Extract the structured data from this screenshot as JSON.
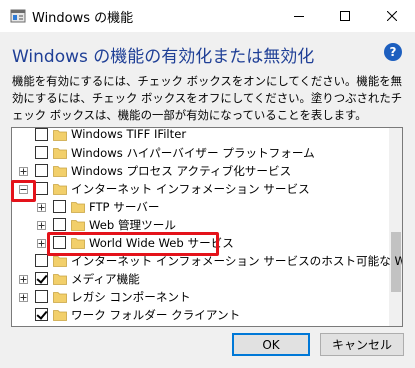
{
  "window": {
    "title": "Windows の機能",
    "heading": "Windows の機能の有効化または無効化",
    "description": "機能を有効にするには、チェック ボックスをオンにしてください。機能を無効にするには、チェック ボックスをオフにしてください。塗りつぶされたチェック ボックスは、機能の一部が有効になっていることを表します。",
    "help": "?"
  },
  "features": [
    {
      "label": "Windows TIFF IFilter",
      "level": 0,
      "expander": "none",
      "state": "unchecked"
    },
    {
      "label": "Windows ハイパーバイザー プラットフォーム",
      "level": 0,
      "expander": "none",
      "state": "unchecked"
    },
    {
      "label": "Windows プロセス アクティブ化サービス",
      "level": 0,
      "expander": "plus",
      "state": "unchecked"
    },
    {
      "label": "インターネット インフォメーション サービス",
      "level": 0,
      "expander": "minus",
      "state": "unchecked"
    },
    {
      "label": "FTP サーバー",
      "level": 1,
      "expander": "plus",
      "state": "unchecked"
    },
    {
      "label": "Web 管理ツール",
      "level": 1,
      "expander": "plus",
      "state": "unchecked"
    },
    {
      "label": "World Wide Web サービス",
      "level": 1,
      "expander": "plus",
      "state": "unchecked"
    },
    {
      "label": "インターネット インフォメーション サービスのホスト可能な Web コア",
      "level": 0,
      "expander": "none",
      "state": "unchecked"
    },
    {
      "label": "メディア機能",
      "level": 0,
      "expander": "plus",
      "state": "checked"
    },
    {
      "label": "レガシ コンポーネント",
      "level": 0,
      "expander": "plus",
      "state": "unchecked"
    },
    {
      "label": "ワーク フォルダー クライアント",
      "level": 0,
      "expander": "none",
      "state": "checked"
    }
  ],
  "buttons": {
    "ok": "OK",
    "cancel": "キャンセル"
  },
  "colors": {
    "heading": "#1f3f96",
    "highlight": "#e4121a",
    "folder": "#f2cf6a",
    "ok_border": "#0078d7"
  }
}
